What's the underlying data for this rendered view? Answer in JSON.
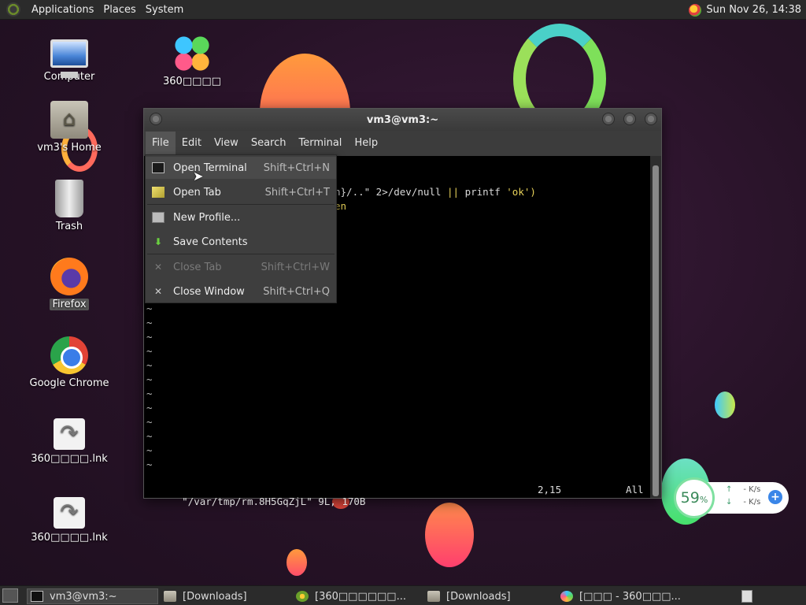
{
  "top_panel": {
    "menus": [
      "Applications",
      "Places",
      "System"
    ],
    "clock": "Sun Nov 26, 14:38"
  },
  "desktop_icons": [
    {
      "label": "Computer"
    },
    {
      "label": "360□□□□"
    },
    {
      "label": "vm3's Home"
    },
    {
      "label": "Trash"
    },
    {
      "label": "Firefox"
    },
    {
      "label": "Google Chrome"
    },
    {
      "label": "360□□□□.lnk"
    },
    {
      "label": "360□□□□.lnk"
    }
  ],
  "window": {
    "title": "vm3@vm3:~",
    "menu": [
      "File",
      "Edit",
      "View",
      "Search",
      "Terminal",
      "Help"
    ]
  },
  "file_menu": [
    {
      "label": "Open Terminal",
      "shortcut": "Shift+Ctrl+N",
      "enabled": true
    },
    {
      "label": "Open Tab",
      "shortcut": "Shift+Ctrl+T",
      "enabled": true
    },
    {
      "label": "New Profile...",
      "shortcut": "",
      "enabled": true
    },
    {
      "label": "Save Contents",
      "shortcut": "",
      "enabled": true
    },
    {
      "label": "Close Tab",
      "shortcut": "Shift+Ctrl+W",
      "enabled": false
    },
    {
      "label": "Close Window",
      "shortcut": "Shift+Ctrl+Q",
      "enabled": true
    }
  ],
  "terminal": {
    "line1_a": "n}/..\" 2>/dev/null ",
    "line1_b": "||",
    "line1_c": " printf ",
    "line1_d": "'ok')",
    "line2": "en",
    "tilde": "~",
    "status_file": "\"/var/tmp/rm.8H5GqZjL\" 9L, 170B",
    "status_pos": "2,15",
    "status_scroll": "All"
  },
  "net_widget": {
    "percent": "59",
    "percent_sign": "%",
    "up": "- K/s",
    "down": "- K/s",
    "up_arrow": "↑",
    "down_arrow": "↓",
    "plus": "+"
  },
  "taskbar": [
    {
      "label": "vm3@vm3:~",
      "active": true
    },
    {
      "label": "[Downloads]",
      "active": false
    },
    {
      "label": "[360□□□□□□...",
      "active": false
    },
    {
      "label": "[Downloads]",
      "active": false
    },
    {
      "label": "[□□□ - 360□□□...",
      "active": false
    }
  ]
}
